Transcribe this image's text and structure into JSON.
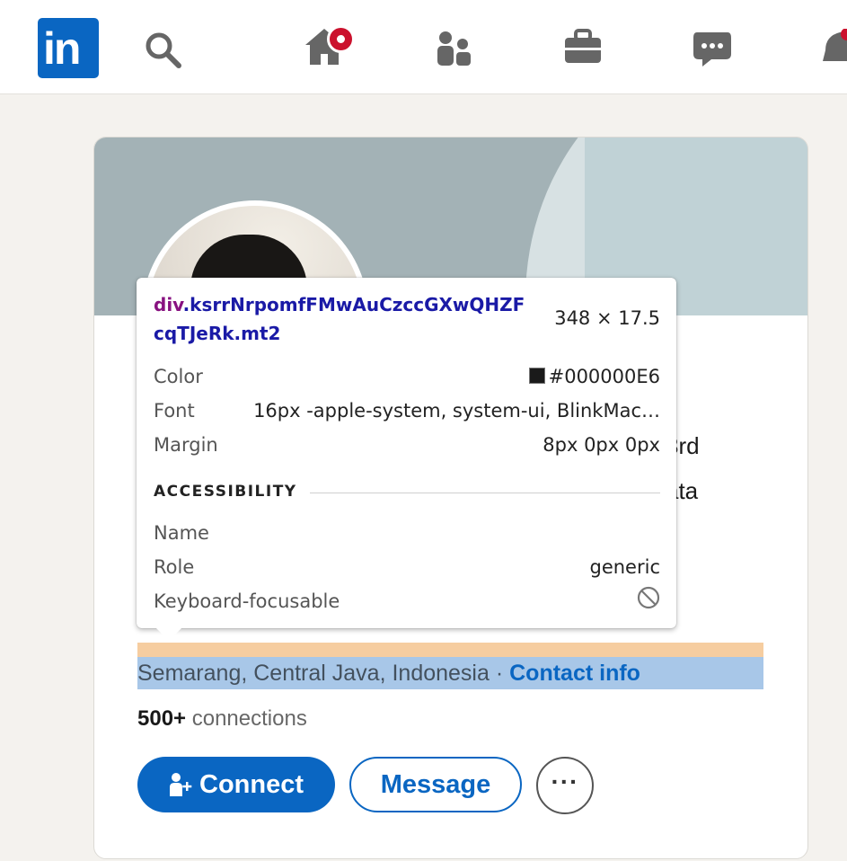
{
  "nav": {
    "logo_text": "in",
    "icons": [
      "search-icon",
      "home-icon",
      "my-network-icon",
      "jobs-icon",
      "messaging-icon",
      "notifications-icon"
    ],
    "home_has_notification": true,
    "brand_color": "#0a66c2",
    "notification_color": "#cb112d"
  },
  "profile": {
    "headline_peek_1": "3rd",
    "headline_peek_2": "ata",
    "location": "Semarang, Central Java, Indonesia",
    "separator": " · ",
    "contact_info": "Contact info",
    "connections_count": "500+",
    "connections_label": " connections",
    "connect_label": "Connect",
    "message_label": "Message",
    "more_label": "···"
  },
  "inspector": {
    "tag": "div",
    "selector": ".ksrrNrpomfFMwAuCzccGXwQHZFcqTJeRk.mt2",
    "size": "348 × 17.5",
    "color_label": "Color",
    "color_value": "#000000E6",
    "font_label": "Font",
    "font_value": "16px -apple-system, system-ui, BlinkMac…",
    "margin_label": "Margin",
    "margin_value": "8px 0px 0px",
    "accessibility_label": "ACCESSIBILITY",
    "name_label": "Name",
    "role_label": "Role",
    "role_value": "generic",
    "focusable_label": "Keyboard-focusable",
    "focusable_icon": "not-allowed-icon"
  }
}
